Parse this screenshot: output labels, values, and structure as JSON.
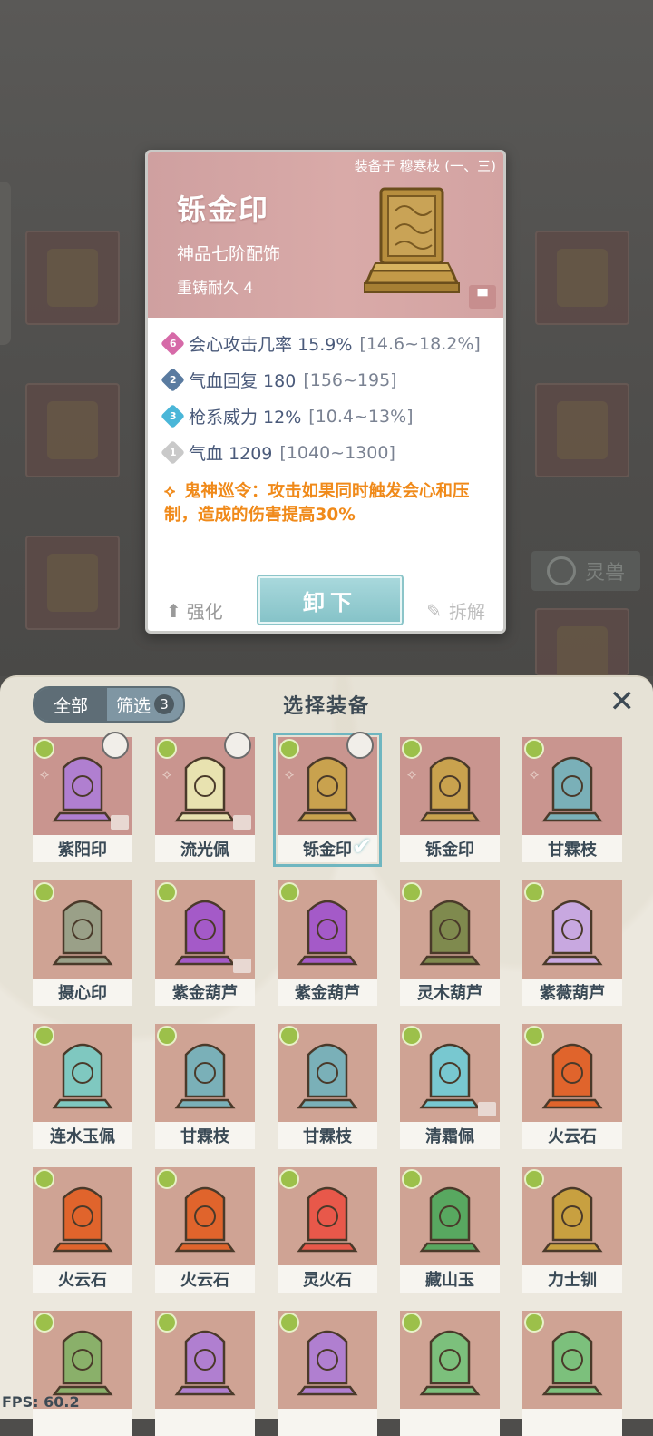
{
  "background": {
    "tab_label": "灵兽"
  },
  "card": {
    "equipped_on": "装备于 穆寒枝 (一、三)",
    "title": "铄金印",
    "grade": "神品七阶配饰",
    "durability": "重铸耐久 4",
    "stats": [
      {
        "rank": "6",
        "text": "会心攻击几率 15.9%",
        "range": "[14.6~18.2%]",
        "gem_color": "#d66aa8"
      },
      {
        "rank": "2",
        "text": "气血回复 180",
        "range": "[156~195]",
        "gem_color": "#5a7ba0"
      },
      {
        "rank": "3",
        "text": "枪系威力 12%",
        "range": "[10.4~13%]",
        "gem_color": "#4ab6d8"
      },
      {
        "rank": "1",
        "text": "气血 1209",
        "range": "[1040~1300]",
        "gem_color": "#c9c9c9"
      }
    ],
    "special": "鬼神巡令：攻击如果同时触发会心和压制，造成的伤害提高30%",
    "unequip": "卸下",
    "enhance": "强化",
    "dismantle": "拆解"
  },
  "panel": {
    "tab_all": "全部",
    "tab_filter": "筛选",
    "filter_count": "3",
    "title": "选择装备",
    "close_icon": "close-icon"
  },
  "items": [
    {
      "name": "紫阳印",
      "icon": "purple-seal-icon",
      "color": "#b07fd0"
    },
    {
      "name": "流光佩",
      "icon": "swirl-pendant-icon",
      "color": "#e8e2b0"
    },
    {
      "name": "铄金印",
      "icon": "gold-seal-icon",
      "color": "#c9a24e",
      "selected": true
    },
    {
      "name": "铄金印",
      "icon": "gold-seal-icon",
      "color": "#c9a24e"
    },
    {
      "name": "甘霖枝",
      "icon": "willow-branch-icon",
      "color": "#7ab0b8"
    },
    {
      "name": "摄心印",
      "icon": "violet-seal-icon",
      "color": "#9aa088"
    },
    {
      "name": "紫金葫芦",
      "icon": "purple-gourd-icon",
      "color": "#a45ac8"
    },
    {
      "name": "紫金葫芦",
      "icon": "purple-gourd-icon",
      "color": "#a45ac8"
    },
    {
      "name": "灵木葫芦",
      "icon": "wood-gourd-icon",
      "color": "#7f8a4e"
    },
    {
      "name": "紫薇葫芦",
      "icon": "lilac-gourd-icon",
      "color": "#c8a8e0"
    },
    {
      "name": "连水玉佩",
      "icon": "jade-ring-icon",
      "color": "#7fc8c0"
    },
    {
      "name": "甘霖枝",
      "icon": "willow-branch-icon",
      "color": "#7ab0b8"
    },
    {
      "name": "甘霖枝",
      "icon": "willow-branch-icon",
      "color": "#7ab0b8"
    },
    {
      "name": "清霜佩",
      "icon": "frost-pendant-icon",
      "color": "#78c8d0"
    },
    {
      "name": "火云石",
      "icon": "fire-stone-icon",
      "color": "#e0642c"
    },
    {
      "name": "火云石",
      "icon": "fire-stone-icon",
      "color": "#e0642c"
    },
    {
      "name": "火云石",
      "icon": "fire-stone-icon",
      "color": "#e0642c"
    },
    {
      "name": "灵火石",
      "icon": "spirit-fire-stone-icon",
      "color": "#e8584a"
    },
    {
      "name": "藏山玉",
      "icon": "mountain-jade-icon",
      "color": "#58a860"
    },
    {
      "name": "力士钏",
      "icon": "gold-bracelet-icon",
      "color": "#c8a040"
    },
    {
      "name": "",
      "icon": "dragon-ornament-icon",
      "color": "#8ab06a"
    },
    {
      "name": "",
      "icon": "purple-seal-icon",
      "color": "#b07fd0"
    },
    {
      "name": "",
      "icon": "purple-seal-icon",
      "color": "#b07fd0"
    },
    {
      "name": "",
      "icon": "jade-dragon-icon",
      "color": "#7cc07c"
    },
    {
      "name": "",
      "icon": "jade-dragon-icon",
      "color": "#7cc07c"
    }
  ],
  "fps": "FPS: 60.2"
}
